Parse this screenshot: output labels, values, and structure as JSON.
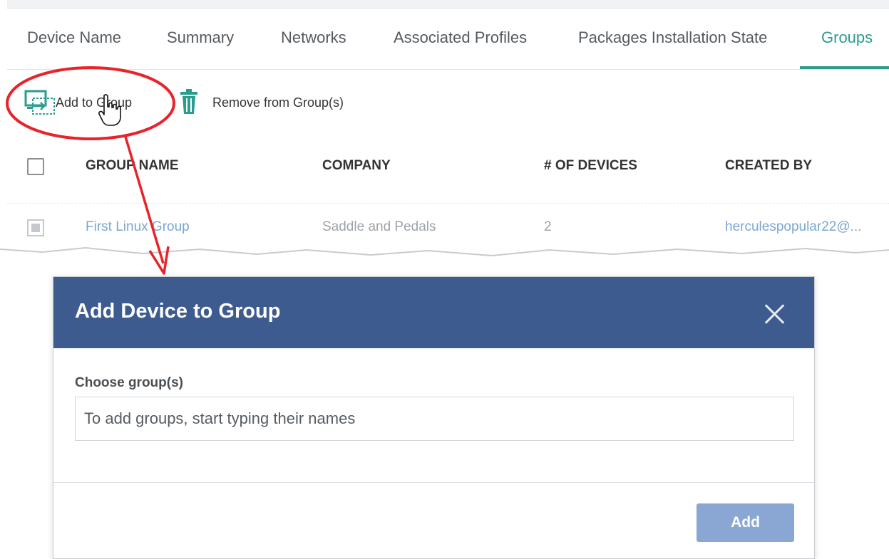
{
  "tabs": [
    {
      "label": "Device Name"
    },
    {
      "label": "Summary"
    },
    {
      "label": "Networks"
    },
    {
      "label": "Associated Profiles"
    },
    {
      "label": "Packages Installation State"
    },
    {
      "label": "Groups",
      "active": true
    }
  ],
  "toolbar": {
    "add_label": "Add to Group",
    "remove_label": "Remove from Group(s)"
  },
  "table": {
    "columns": [
      "GROUP NAME",
      "COMPANY",
      "# OF DEVICES",
      "CREATED BY"
    ],
    "rows": [
      {
        "group_name": "First Linux Group",
        "company": "Saddle and Pedals",
        "devices": "2",
        "created_by": "herculespopular22@..."
      }
    ]
  },
  "dialog": {
    "title": "Add Device to Group",
    "field_label": "Choose group(s)",
    "placeholder": "To add groups, start typing their names",
    "submit_label": "Add"
  },
  "colors": {
    "accent": "#2a9d8f",
    "dialog_header": "#3e5b8f",
    "button": "#8aa7d3",
    "annotation": "#e8232a"
  },
  "icons": [
    "add-to-group-icon",
    "trash-icon",
    "hand-cursor-icon",
    "close-icon"
  ]
}
